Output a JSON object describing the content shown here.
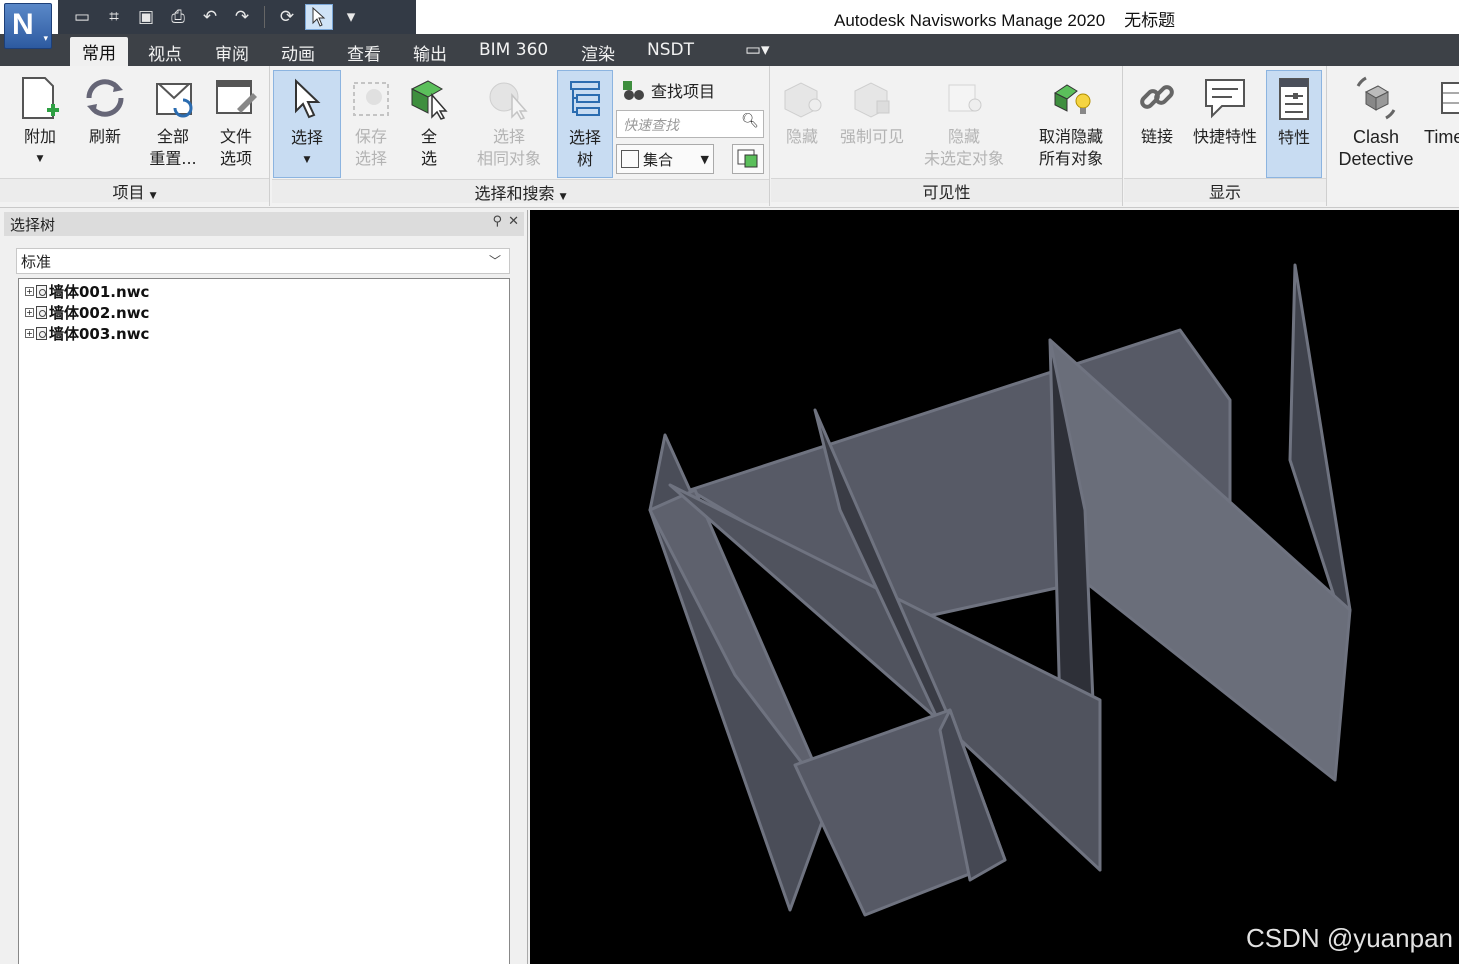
{
  "title": {
    "app_name": "Autodesk Navisworks Manage 2020",
    "document": "无标题",
    "app_button_letter": "N"
  },
  "quick_access": [
    "new-icon",
    "open-icon",
    "save-icon",
    "print-icon",
    "undo-icon",
    "redo-icon",
    "refresh-icon",
    "select-icon",
    "customize-icon"
  ],
  "tabs": [
    {
      "label": "常用",
      "active": true
    },
    {
      "label": "视点"
    },
    {
      "label": "审阅"
    },
    {
      "label": "动画"
    },
    {
      "label": "查看"
    },
    {
      "label": "输出"
    },
    {
      "label": "BIM 360"
    },
    {
      "label": "渲染"
    },
    {
      "label": "NSDT"
    }
  ],
  "ribbon": {
    "project": {
      "title": "项目",
      "append": "附加",
      "refresh": "刷新",
      "reset_all_1": "全部",
      "reset_all_2": "重置...",
      "file_options_1": "文件",
      "file_options_2": "选项"
    },
    "select_search": {
      "title": "选择和搜索",
      "select": "选择",
      "save_sel_1": "保存",
      "save_sel_2": "选择",
      "select_all_1": "全",
      "select_all_2": "选",
      "same_1": "选择",
      "same_2": "相同对象",
      "tree_1": "选择",
      "tree_2": "树",
      "find_items": "查找项目",
      "quick_find_placeholder": "快速查找",
      "sets": "集合"
    },
    "visibility": {
      "title": "可见性",
      "hide": "隐藏",
      "require": "强制可见",
      "hide_unsel_1": "隐藏",
      "hide_unsel_2": "未选定对象",
      "unhide_1": "取消隐藏",
      "unhide_2": "所有对象"
    },
    "display": {
      "title": "显示",
      "links": "链接",
      "quick_props": "快捷特性",
      "properties": "特性"
    },
    "tools": {
      "clash_1": "Clash",
      "clash_2": "Detective",
      "timeliner": "Time"
    }
  },
  "selection_tree": {
    "title": "选择树",
    "mode": "标准",
    "items": [
      "墙体001.nwc",
      "墙体002.nwc",
      "墙体003.nwc"
    ]
  },
  "viewport": {
    "background": "#000000",
    "wall_color": "#575a66",
    "watermark": "CSDN @yuanpan"
  }
}
